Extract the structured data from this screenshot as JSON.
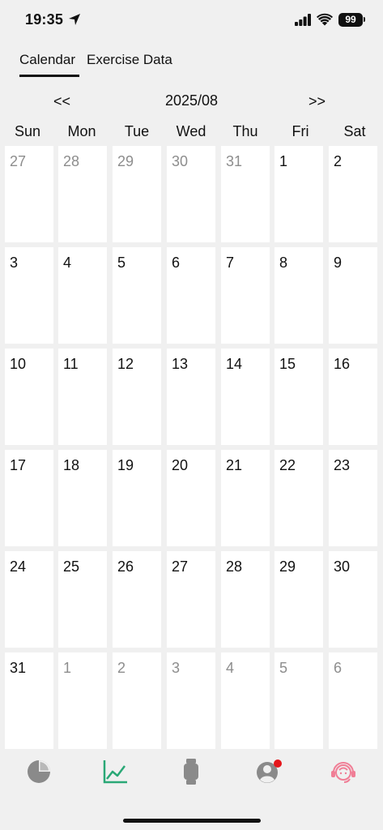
{
  "status": {
    "time": "19:35",
    "battery": "99"
  },
  "tabs": [
    {
      "label": "Calendar",
      "active": true
    },
    {
      "label": "Exercise Data",
      "active": false
    }
  ],
  "nav": {
    "prev": "<<",
    "title": "2025/08",
    "next": ">>"
  },
  "weekdays": [
    "Sun",
    "Mon",
    "Tue",
    "Wed",
    "Thu",
    "Fri",
    "Sat"
  ],
  "weeks": [
    [
      {
        "d": "27",
        "m": true
      },
      {
        "d": "28",
        "m": true
      },
      {
        "d": "29",
        "m": true
      },
      {
        "d": "30",
        "m": true
      },
      {
        "d": "31",
        "m": true
      },
      {
        "d": "1",
        "m": false
      },
      {
        "d": "2",
        "m": false
      }
    ],
    [
      {
        "d": "3",
        "m": false
      },
      {
        "d": "4",
        "m": false
      },
      {
        "d": "5",
        "m": false
      },
      {
        "d": "6",
        "m": false
      },
      {
        "d": "7",
        "m": false
      },
      {
        "d": "8",
        "m": false
      },
      {
        "d": "9",
        "m": false
      }
    ],
    [
      {
        "d": "10",
        "m": false
      },
      {
        "d": "11",
        "m": false
      },
      {
        "d": "12",
        "m": false
      },
      {
        "d": "13",
        "m": false
      },
      {
        "d": "14",
        "m": false
      },
      {
        "d": "15",
        "m": false
      },
      {
        "d": "16",
        "m": false
      }
    ],
    [
      {
        "d": "17",
        "m": false
      },
      {
        "d": "18",
        "m": false
      },
      {
        "d": "19",
        "m": false
      },
      {
        "d": "20",
        "m": false
      },
      {
        "d": "21",
        "m": false
      },
      {
        "d": "22",
        "m": false
      },
      {
        "d": "23",
        "m": false
      }
    ],
    [
      {
        "d": "24",
        "m": false
      },
      {
        "d": "25",
        "m": false
      },
      {
        "d": "26",
        "m": false
      },
      {
        "d": "27",
        "m": false
      },
      {
        "d": "28",
        "m": false
      },
      {
        "d": "29",
        "m": false
      },
      {
        "d": "30",
        "m": false
      }
    ],
    [
      {
        "d": "31",
        "m": false
      },
      {
        "d": "1",
        "m": true
      },
      {
        "d": "2",
        "m": true
      },
      {
        "d": "3",
        "m": true
      },
      {
        "d": "4",
        "m": true
      },
      {
        "d": "5",
        "m": true
      },
      {
        "d": "6",
        "m": true
      }
    ]
  ],
  "bottom_nav": [
    {
      "icon": "pie-chart-icon",
      "color": "#8a8a8a"
    },
    {
      "icon": "line-chart-icon",
      "color": "#2aa876"
    },
    {
      "icon": "watch-icon",
      "color": "#8a8a8a"
    },
    {
      "icon": "profile-icon",
      "color": "#8a8a8a",
      "badge_color": "#e5161b"
    },
    {
      "icon": "support-agent-icon",
      "color": "#f07e96"
    }
  ]
}
